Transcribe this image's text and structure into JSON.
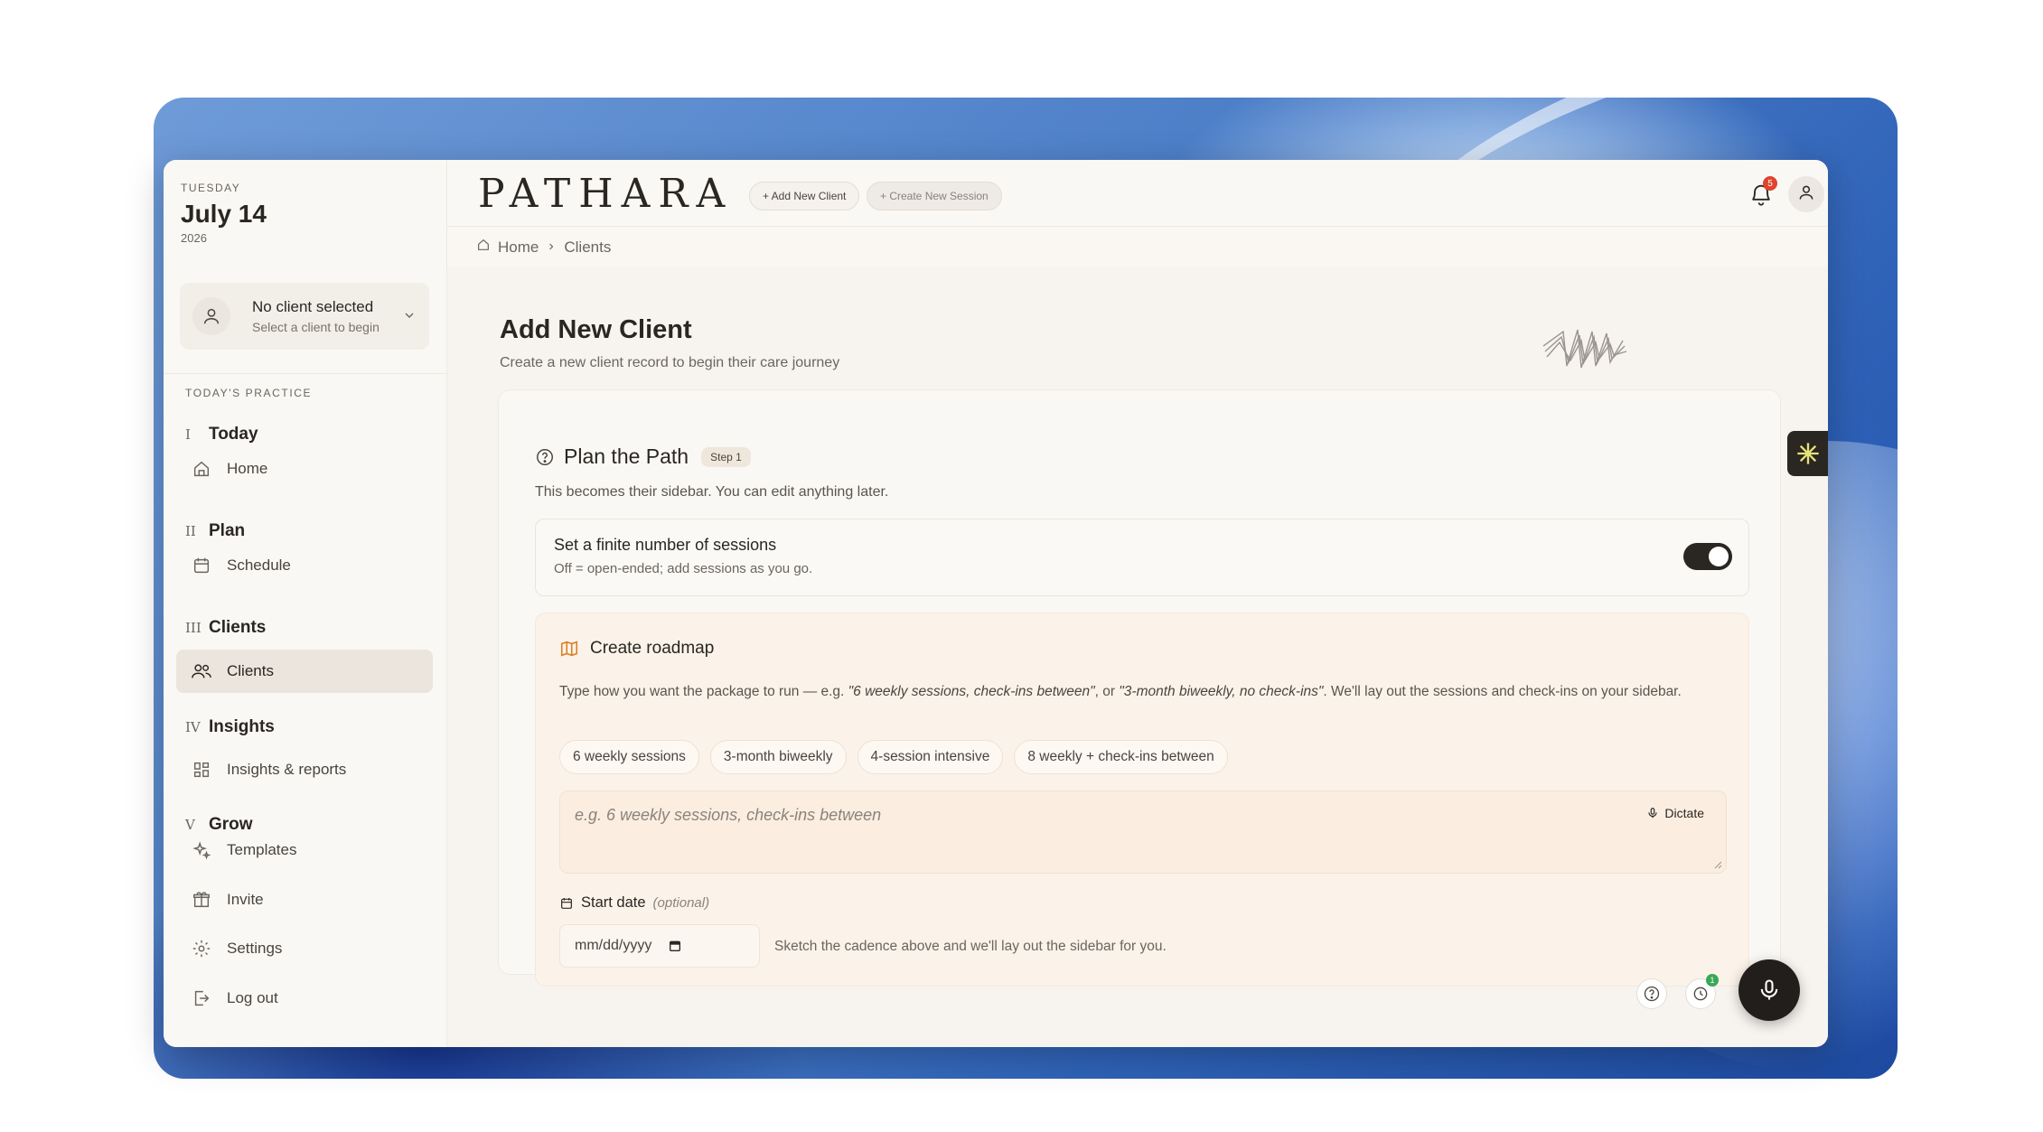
{
  "sidebar": {
    "date": {
      "weekday": "TUESDAY",
      "day": "July 14",
      "year": "2026"
    },
    "client_selector": {
      "title": "No client selected",
      "subtitle": "Select a client to begin"
    },
    "section_label": "TODAY'S PRACTICE",
    "groups": [
      {
        "num": "I",
        "label": "Today",
        "items": [
          {
            "label": "Home",
            "icon": "home-icon"
          }
        ]
      },
      {
        "num": "II",
        "label": "Plan",
        "items": [
          {
            "label": "Schedule",
            "icon": "calendar-icon"
          }
        ]
      },
      {
        "num": "III",
        "label": "Clients",
        "items": [
          {
            "label": "Clients",
            "icon": "users-icon",
            "active": true
          }
        ]
      },
      {
        "num": "IV",
        "label": "Insights",
        "items": [
          {
            "label": "Insights & reports",
            "icon": "grid-icon"
          }
        ]
      },
      {
        "num": "V",
        "label": "Grow",
        "items": [
          {
            "label": "Templates",
            "icon": "sparkles-icon"
          },
          {
            "label": "Invite",
            "icon": "gift-icon"
          },
          {
            "label": "Settings",
            "icon": "gear-icon"
          },
          {
            "label": "Log out",
            "icon": "logout-icon"
          }
        ]
      }
    ]
  },
  "topbar": {
    "logo": "PATHARA",
    "add_client": "+ Add New Client",
    "create_session": "+ Create New Session",
    "notification_count": "5"
  },
  "breadcrumb": {
    "home": "Home",
    "current": "Clients"
  },
  "page": {
    "title": "Add New Client",
    "subtitle": "Create a new client record to begin their care journey"
  },
  "step": {
    "title": "Plan the Path",
    "badge": "Step 1",
    "subtitle": "This becomes their sidebar. You can edit anything later.",
    "toggle": {
      "label": "Set a finite number of sessions",
      "hint": "Off = open-ended; add sessions as you go.",
      "on": true
    }
  },
  "roadmap": {
    "title": "Create roadmap",
    "desc_prefix": "Type how you want the package to run — e.g. ",
    "desc_ex1": "\"6 weekly sessions, check-ins between\"",
    "desc_mid": ", or ",
    "desc_ex2": "\"3-month biweekly, no check-ins\"",
    "desc_suffix": ". We'll lay out the sessions and check-ins on your sidebar.",
    "chips": [
      "6 weekly sessions",
      "3-month biweekly",
      "4-session intensive",
      "8 weekly + check-ins between"
    ],
    "input_placeholder": "e.g. 6 weekly sessions, check-ins between",
    "dictate": "Dictate",
    "start_date_label": "Start date",
    "start_date_optional": "(optional)",
    "date_placeholder": "mm/dd/yyyy",
    "hint": "Sketch the cadence above and we'll lay out the sidebar for you."
  },
  "floating": {
    "activity_count": "1"
  },
  "colors": {
    "accent_dark": "#2a2622",
    "badge_red": "#e0442c",
    "badge_green": "#3aa856",
    "roadmap_bg": "#fbf3ea"
  }
}
